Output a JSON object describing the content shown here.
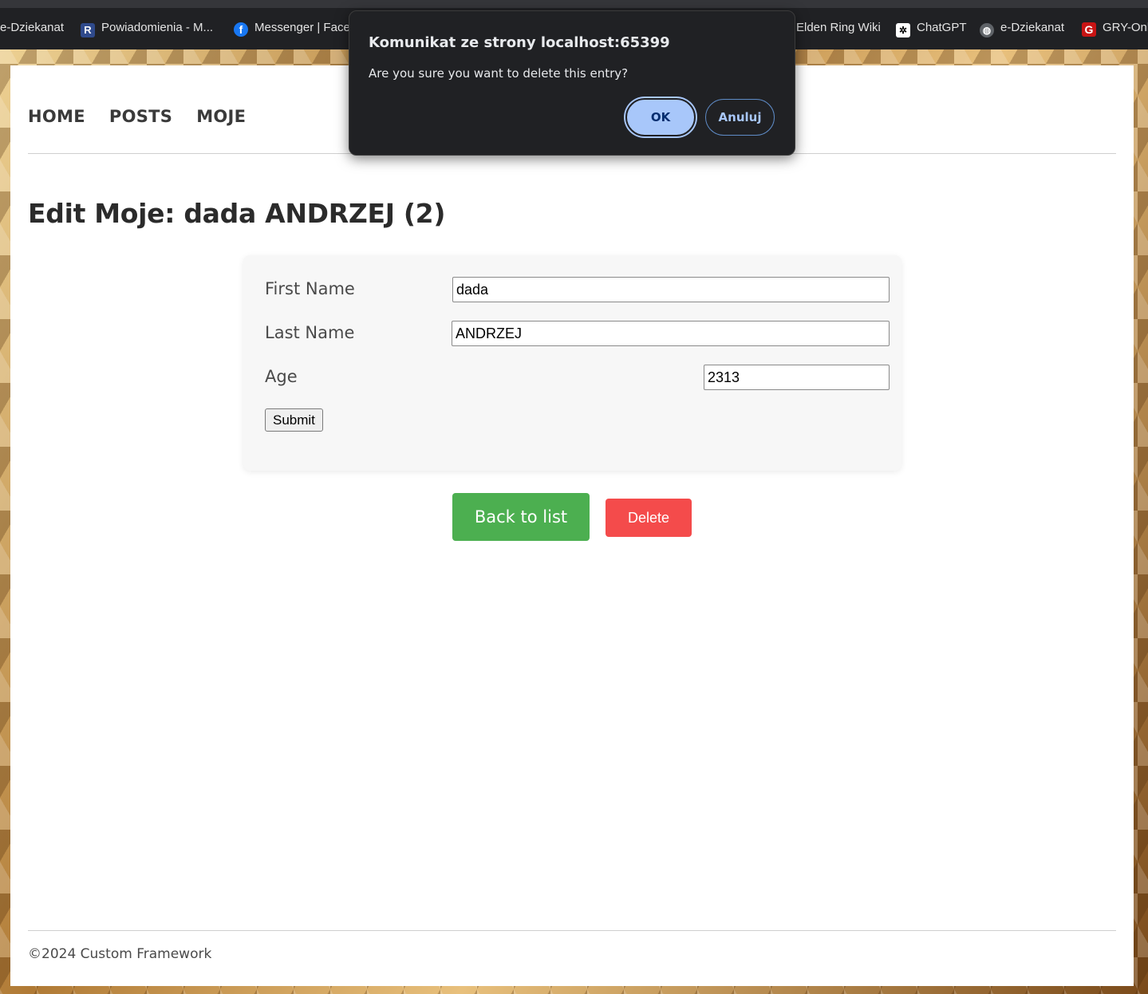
{
  "bookmarks": {
    "edziekanat_1": "e-Dziekanat",
    "powiadomienia": "Powiadomienia - M...",
    "messenger": "Messenger | Facebook",
    "elden_ring": "Elden Ring Wiki",
    "chatgpt": "ChatGPT",
    "edziekanat_2": "e-Dziekanat",
    "gry_online": "GRY-Online"
  },
  "nav": {
    "home": "HOME",
    "posts": "POSTS",
    "moje": "MOJE"
  },
  "page_title": "Edit Moje: dada ANDRZEJ (2)",
  "form": {
    "first_name_label": "First Name",
    "first_name_value": "dada",
    "last_name_label": "Last Name",
    "last_name_value": "ANDRZEJ",
    "age_label": "Age",
    "age_value": "2313",
    "submit_label": "Submit"
  },
  "actions": {
    "back_label": "Back to list",
    "delete_label": "Delete"
  },
  "footer": "©2024 Custom Framework",
  "dialog": {
    "title": "Komunikat ze strony localhost:65399",
    "message": "Are you sure you want to delete this entry?",
    "ok_label": "OK",
    "cancel_label": "Anuluj"
  },
  "colors": {
    "back_button": "#4caf50",
    "delete_button": "#f44b4b",
    "dialog_bg": "#202124",
    "dialog_ok": "#a8c7fa"
  },
  "icons": {
    "powiadomienia": "r-letter-icon",
    "messenger": "facebook-icon",
    "chatgpt": "openai-icon",
    "edziekanat_2": "globe-icon",
    "gry_online": "g-letter-icon"
  }
}
